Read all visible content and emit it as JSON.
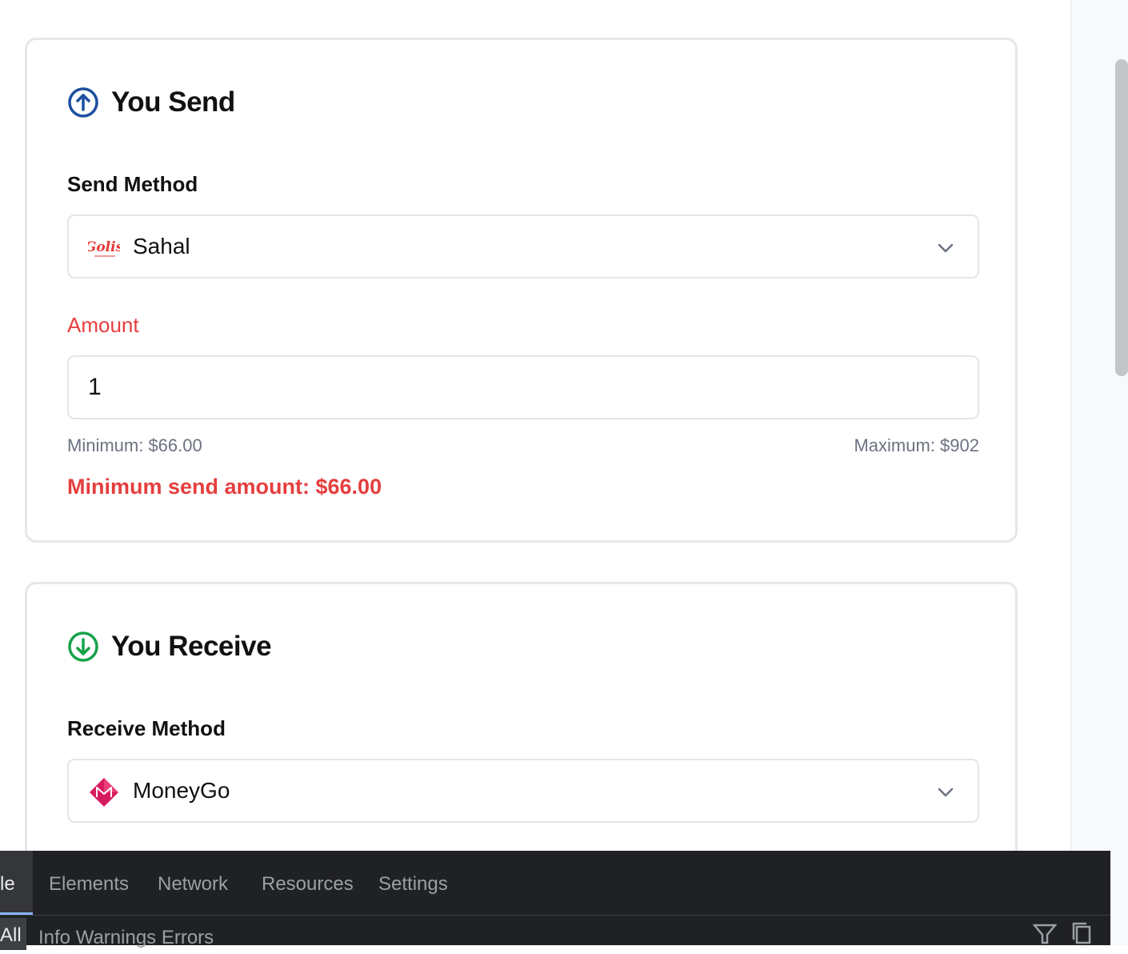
{
  "send_card": {
    "title": "You Send",
    "method_label": "Send Method",
    "method_value": "Sahal",
    "method_logo_text": "Golis",
    "amount_label": "Amount",
    "amount_value": "1",
    "minimum_text": "Minimum: $66.00",
    "maximum_text": "Maximum: $902",
    "error_text": "Minimum send amount: $66.00",
    "icon": "arrow-up-circle-icon",
    "icon_color": "#1e4fa0"
  },
  "receive_card": {
    "title": "You Receive",
    "method_label": "Receive Method",
    "method_value": "MoneyGo",
    "icon": "arrow-down-circle-icon",
    "icon_color": "#16a34a",
    "logo_color": "#d81b60"
  },
  "devtools": {
    "tabs": [
      "le",
      "Elements",
      "Network",
      "Resources",
      "Settings"
    ],
    "active_tab": "le",
    "filter_all": "All",
    "levels": "Info   Warnings   Errors"
  },
  "colors": {
    "error": "#e53e3e",
    "border": "#e5e7eb",
    "devtools_bg": "#202124",
    "accent": "#8ab4f8"
  }
}
